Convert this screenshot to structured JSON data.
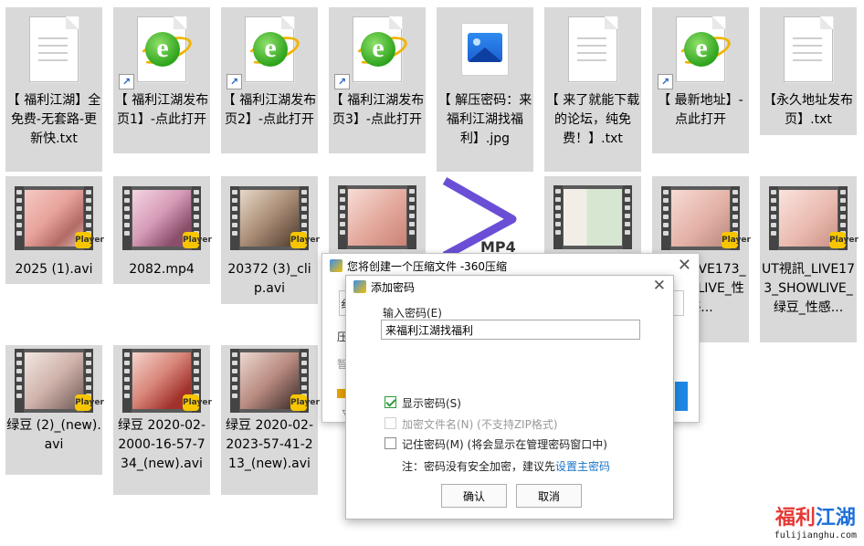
{
  "files": [
    {
      "name": "【 福利江湖】全免费-无套路-更新快.txt",
      "type": "txt"
    },
    {
      "name": "【 福利江湖发布页1】-点此打开",
      "type": "ie"
    },
    {
      "name": "【 福利江湖发布页2】-点此打开",
      "type": "ie"
    },
    {
      "name": "【 福利江湖发布页3】-点此打开",
      "type": "ie"
    },
    {
      "name": "【 解压密码：来福利江湖找福利】.jpg",
      "type": "jpg"
    },
    {
      "name": "【 来了就能下载的论坛，纯免费！】.txt",
      "type": "txt"
    },
    {
      "name": "【 最新地址】-点此打开",
      "type": "ie"
    },
    {
      "name": "【永久地址发布页】.txt",
      "type": "txt"
    },
    {
      "name": "2025 (1).avi",
      "type": "video"
    },
    {
      "name": "2082.mp4",
      "type": "video"
    },
    {
      "name": "20372 (3)_clip.avi",
      "type": "video"
    },
    {
      "name": "",
      "type": "video"
    },
    {
      "name": "",
      "type": "player"
    },
    {
      "name": "",
      "type": "video"
    },
    {
      "name": "視訊_LIVE173_SHOWLIVE_性感...",
      "type": "video"
    },
    {
      "name": "UT視訊_LIVE173_SHOWLIVE_绿豆_性感...",
      "type": "video"
    },
    {
      "name": "绿豆 (2)_(new).avi",
      "type": "video"
    },
    {
      "name": "绿豆 2020-02-2000-16-57-734_(new).avi",
      "type": "video"
    },
    {
      "name": "绿豆 2020-02-2023-57-41-213_(new).avi",
      "type": "video"
    }
  ],
  "shortcut_glyph": "↗",
  "badge_text": "Player",
  "player_label": "MP4",
  "compress_dialog": {
    "title": "您将创建一个压缩文件 -360压缩",
    "close": "✕",
    "frag_a": "纟",
    "frag_b": "压",
    "frag_c": "智",
    "frag_d": "▽"
  },
  "password_dialog": {
    "title": "添加密码",
    "close": "✕",
    "password_label": "输入密码(E)",
    "password_value": "来福利江湖找福利",
    "show_password_label": "显示密码(S)",
    "show_password_checked": true,
    "encrypt_names_label": "加密文件名(N) (不支持ZIP格式)",
    "encrypt_names_enabled": false,
    "remember_label": "记住密码(M) (将会显示在管理密码窗口中)",
    "remember_checked": false,
    "note_prefix": "注：密码没有安全加密，建议先",
    "note_link": "设置主密码",
    "ok_label": "确认",
    "cancel_label": "取消"
  },
  "watermark": {
    "part1": "福利",
    "part2": "江湖",
    "url": "fulijianghu.com"
  }
}
